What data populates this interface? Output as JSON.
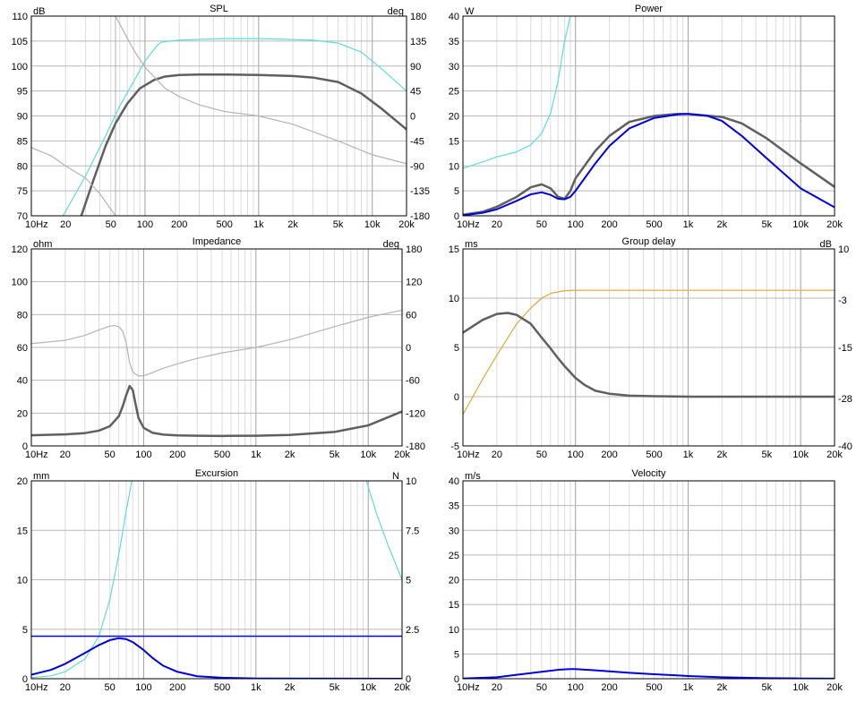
{
  "colors": {
    "dark": "#5f5f5f",
    "light_gray": "#b4b4b4",
    "cyan": "#5fdcdc",
    "blue": "#0000dd",
    "orange": "#e0a838"
  },
  "x_axis": {
    "scale": "log",
    "range": [
      10,
      20000
    ],
    "tick_values": [
      10,
      20,
      50,
      100,
      200,
      500,
      1000,
      2000,
      5000,
      10000,
      20000
    ],
    "tick_labels": [
      "10Hz",
      "20",
      "50",
      "100",
      "200",
      "500",
      "1k",
      "2k",
      "5k",
      "10k",
      "20k"
    ]
  },
  "chart_data": [
    {
      "type": "line",
      "title": "SPL",
      "left_unit": "dB",
      "right_unit": "deg",
      "ylim": [
        70,
        110
      ],
      "yticks": [
        70,
        75,
        80,
        85,
        90,
        95,
        100,
        105,
        110
      ],
      "y2lim": [
        -180,
        180
      ],
      "y2ticks": [
        -180,
        -135,
        -90,
        -45,
        0,
        45,
        90,
        135,
        180
      ],
      "marker_x": 55,
      "series": [
        {
          "color": "cyan",
          "axis": "left",
          "x": [
            10,
            19,
            30,
            45,
            60,
            80,
            100,
            130,
            140,
            200,
            500,
            1000,
            3000,
            5000,
            8000,
            12000,
            20000
          ],
          "y": [
            65,
            70,
            78,
            86,
            92,
            97,
            101,
            104.3,
            104.8,
            105.2,
            105.5,
            105.5,
            105.2,
            104.6,
            102.8,
            99.5,
            95
          ]
        },
        {
          "color": "dark",
          "axis": "left",
          "width": 2.5,
          "x": [
            10,
            20,
            28,
            35,
            45,
            55,
            70,
            90,
            120,
            150,
            200,
            300,
            500,
            1000,
            2000,
            3000,
            5000,
            8000,
            12000,
            20000
          ],
          "y": [
            50,
            62,
            70.5,
            77,
            84,
            88.5,
            92.5,
            95.5,
            97.2,
            97.9,
            98.2,
            98.3,
            98.3,
            98.2,
            98,
            97.7,
            96.8,
            94.5,
            91.5,
            87.3
          ]
        },
        {
          "color": "light_gray",
          "axis": "right",
          "x": [
            55,
            80,
            100,
            150,
            200,
            300,
            500,
            1000,
            2000,
            5000,
            10000,
            20000
          ],
          "y": [
            180,
            118,
            88,
            50,
            35,
            20,
            8,
            0,
            -15,
            -45,
            -70,
            -86
          ]
        },
        {
          "color": "light_gray",
          "axis": "right",
          "x": [
            10,
            15,
            20,
            30,
            40,
            50,
            55
          ],
          "y": [
            -57,
            -72,
            -90,
            -112,
            -140,
            -168,
            -180
          ]
        }
      ]
    },
    {
      "type": "line",
      "title": "Power",
      "left_unit": "W",
      "ylim": [
        0,
        40
      ],
      "yticks": [
        0,
        5,
        10,
        15,
        20,
        25,
        30,
        35,
        40
      ],
      "series": [
        {
          "color": "cyan",
          "axis": "left",
          "x": [
            10,
            15,
            20,
            30,
            40,
            50,
            60,
            70,
            80,
            90
          ],
          "y": [
            9.5,
            10.8,
            11.8,
            12.8,
            14.2,
            16.5,
            20.5,
            27,
            35,
            40
          ]
        },
        {
          "color": "dark",
          "axis": "left",
          "width": 2.5,
          "x": [
            10,
            15,
            20,
            30,
            40,
            50,
            60,
            70,
            80,
            90,
            100,
            150,
            200,
            300,
            500,
            800,
            1000,
            2000,
            3000,
            5000,
            10000,
            20000
          ],
          "y": [
            0.2,
            0.8,
            1.8,
            3.8,
            5.7,
            6.3,
            5.5,
            3.8,
            3.4,
            5,
            7.5,
            13,
            16,
            18.8,
            20,
            20.4,
            20.4,
            19.8,
            18.5,
            15.5,
            10.5,
            5.8
          ]
        },
        {
          "color": "blue",
          "axis": "left",
          "width": 2,
          "x": [
            10,
            15,
            20,
            30,
            40,
            50,
            60,
            70,
            80,
            90,
            100,
            150,
            200,
            300,
            500,
            800,
            1000,
            1500,
            2000,
            3000,
            5000,
            10000,
            20000
          ],
          "y": [
            0.1,
            0.6,
            1.3,
            3,
            4.3,
            4.7,
            4.2,
            3.4,
            3.3,
            3.8,
            5,
            10.5,
            14,
            17.5,
            19.6,
            20.3,
            20.4,
            20,
            19,
            16,
            11.5,
            5.5,
            1.7
          ]
        }
      ]
    },
    {
      "type": "line",
      "title": "Impedance",
      "left_unit": "ohm",
      "right_unit": "deg",
      "ylim": [
        0,
        120
      ],
      "yticks": [
        0,
        20,
        40,
        60,
        80,
        100,
        120
      ],
      "y2lim": [
        -180,
        180
      ],
      "y2ticks": [
        -180,
        -120,
        -60,
        0,
        60,
        120,
        180
      ],
      "series": [
        {
          "color": "light_gray",
          "axis": "right",
          "x": [
            10,
            20,
            30,
            40,
            50,
            55,
            60,
            65,
            70,
            75,
            80,
            90,
            100,
            120,
            150,
            200,
            300,
            500,
            1000,
            2000,
            5000,
            10000,
            20000
          ],
          "y": [
            7,
            13,
            22,
            32,
            39,
            40,
            38,
            30,
            8,
            -28,
            -45,
            -52,
            -52,
            -46,
            -38,
            -30,
            -20,
            -10,
            0,
            14,
            38,
            55,
            68
          ]
        },
        {
          "color": "dark",
          "axis": "left",
          "width": 2.5,
          "x": [
            10,
            20,
            30,
            40,
            50,
            60,
            65,
            70,
            75,
            80,
            85,
            90,
            100,
            120,
            150,
            200,
            300,
            500,
            1000,
            2000,
            5000,
            10000,
            20000
          ],
          "y": [
            6.5,
            7,
            7.8,
            9.3,
            12,
            18,
            24,
            31,
            36.5,
            34,
            25,
            17,
            11,
            8,
            6.9,
            6.4,
            6.2,
            6.1,
            6.2,
            6.7,
            8.5,
            12.5,
            21
          ]
        }
      ]
    },
    {
      "type": "line",
      "title": "Group delay",
      "left_unit": "ms",
      "right_unit": "dB",
      "ylim": [
        -5,
        15
      ],
      "yticks": [
        -5,
        0,
        5,
        10,
        15
      ],
      "y2lim": [
        -40,
        10
      ],
      "y2ticks": [
        -40,
        -28,
        -15,
        -3,
        10
      ],
      "series": [
        {
          "color": "orange",
          "axis": "right",
          "x": [
            10,
            15,
            20,
            30,
            40,
            50,
            60,
            80,
            100,
            200,
            500,
            1000,
            5000,
            20000
          ],
          "y": [
            -32,
            -23,
            -17,
            -9,
            -5,
            -2.5,
            -1.3,
            -0.6,
            -0.5,
            -0.5,
            -0.5,
            -0.5,
            -0.5,
            -0.5
          ]
        },
        {
          "color": "dark",
          "axis": "left",
          "width": 2.5,
          "x": [
            10,
            15,
            20,
            25,
            30,
            40,
            50,
            60,
            70,
            80,
            100,
            120,
            150,
            200,
            300,
            500,
            1000,
            2000,
            5000,
            10000,
            20000
          ],
          "y": [
            6.5,
            7.8,
            8.4,
            8.5,
            8.3,
            7.4,
            6,
            4.9,
            3.9,
            3.1,
            1.9,
            1.2,
            0.6,
            0.3,
            0.1,
            0.05,
            0,
            0,
            0,
            0,
            0
          ]
        }
      ]
    },
    {
      "type": "line",
      "title": "Excursion",
      "left_unit": "mm",
      "right_unit": "N",
      "ylim": [
        0,
        20
      ],
      "yticks": [
        0,
        5,
        10,
        15,
        20
      ],
      "ytick_labels": [
        "0",
        "5",
        "10",
        "15",
        "20"
      ],
      "y2lim": [
        0,
        10
      ],
      "y2ticks": [
        0,
        2.5,
        5,
        7.5,
        10
      ],
      "series": [
        {
          "color": "cyan",
          "axis": "left",
          "x": [
            10,
            15,
            20,
            30,
            40,
            50,
            60,
            70,
            80
          ],
          "y": [
            0.1,
            0.3,
            0.7,
            2,
            4.3,
            8,
            12.5,
            17,
            20.5
          ]
        },
        {
          "color": "cyan",
          "axis": "left",
          "x": [
            9500,
            12000,
            15000,
            20000
          ],
          "y": [
            20.2,
            16.5,
            13.5,
            10
          ]
        },
        {
          "color": "blue",
          "axis": "left",
          "width": 1.4,
          "x": [
            10,
            20000
          ],
          "y": [
            4.3,
            4.3
          ]
        },
        {
          "color": "blue",
          "axis": "left",
          "width": 2,
          "x": [
            10,
            15,
            20,
            30,
            40,
            50,
            60,
            70,
            80,
            100,
            120,
            150,
            200,
            300,
            500,
            1000,
            20000
          ],
          "y": [
            0.4,
            0.9,
            1.5,
            2.6,
            3.4,
            3.9,
            4.1,
            4,
            3.7,
            2.9,
            2.1,
            1.3,
            0.7,
            0.25,
            0.1,
            0.02,
            0
          ]
        }
      ]
    },
    {
      "type": "line",
      "title": "Velocity",
      "left_unit": "m/s",
      "ylim": [
        0,
        40
      ],
      "yticks": [
        0,
        5,
        10,
        15,
        20,
        25,
        30,
        35,
        40
      ],
      "series": [
        {
          "color": "blue",
          "axis": "left",
          "width": 2,
          "x": [
            10,
            20,
            30,
            50,
            70,
            90,
            100,
            150,
            200,
            300,
            500,
            1000,
            2000,
            5000,
            10000,
            20000
          ],
          "y": [
            0.05,
            0.3,
            0.8,
            1.4,
            1.8,
            1.95,
            1.95,
            1.7,
            1.5,
            1.2,
            0.9,
            0.55,
            0.3,
            0.12,
            0.05,
            0.02
          ]
        }
      ]
    }
  ]
}
